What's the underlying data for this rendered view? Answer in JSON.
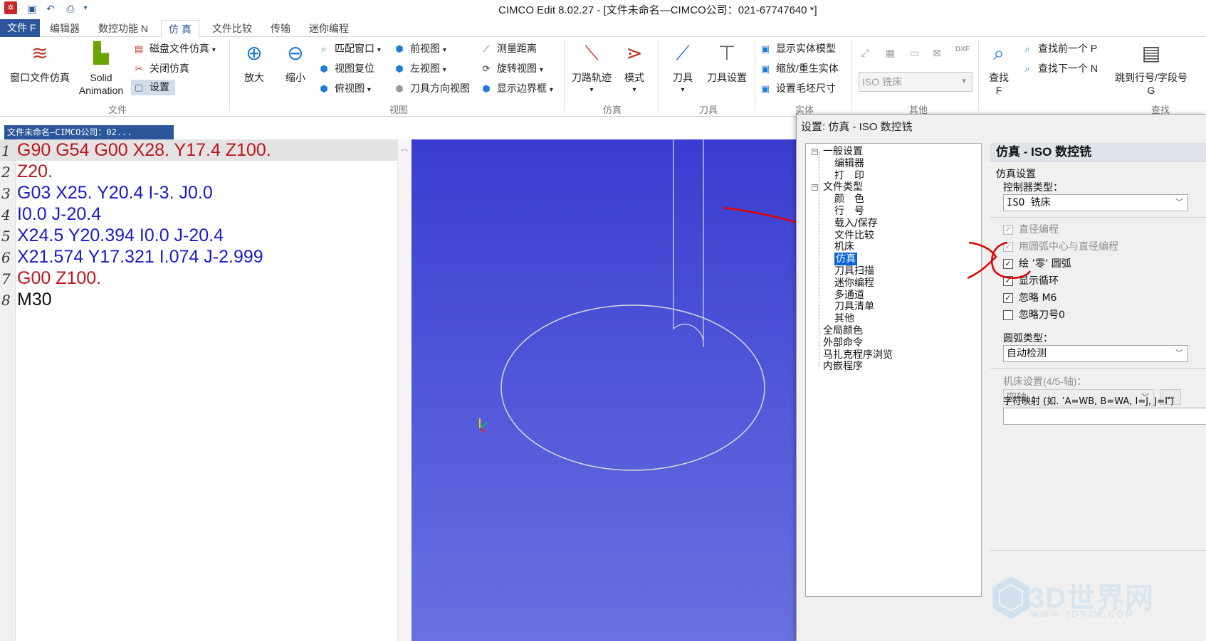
{
  "window": {
    "title": "CIMCO Edit 8.02.27 - [文件未命名—CIMCO公司：021-67747640 *]"
  },
  "tabs": [
    {
      "label": "文件 F"
    },
    {
      "label": "编辑器"
    },
    {
      "label": "数控功能 N"
    },
    {
      "label": "仿 真"
    },
    {
      "label": "文件比较"
    },
    {
      "label": "传输"
    },
    {
      "label": "迷你编程"
    }
  ],
  "ribbon": {
    "file_group": {
      "window_sim": "窗口文件仿真",
      "solid_animation": "Solid Animation",
      "solid_line1": "Solid",
      "solid_line2": "Animation",
      "disk_sim": "磁盘文件仿真",
      "close_sim": "关闭仿真",
      "settings": "设置",
      "label": "文件"
    },
    "view_group": {
      "zoom_in": "放大",
      "zoom_out": "缩小",
      "fit_window": "匹配窗口",
      "view_reset": "视图复位",
      "top_view": "俯视图",
      "front_view": "前视图",
      "left_view": "左视图",
      "tool_dir_view": "刀具方向视图",
      "measure": "测量距离",
      "rotate_view": "旋转视图",
      "show_bounds": "显示边界框",
      "label": "视图"
    },
    "sim_group": {
      "toolpath": "刀路轨迹",
      "mode": "模式",
      "label": "仿真"
    },
    "tool_group": {
      "tool": "刀具",
      "tool_setup": "刀具设置",
      "label": "刀具"
    },
    "solid_group": {
      "show_solid": "显示实体模型",
      "scale_regen": "缩放/重生实体",
      "stock_size": "设置毛坯尺寸",
      "label": "实体"
    },
    "other_group": {
      "machine_combo": "ISO 铣床",
      "label": "其他"
    },
    "find_group": {
      "find": "查找",
      "find_key": "F",
      "find_prev": "查找前一个 P",
      "find_next": "查找下一个 N",
      "goto": "跳到行号/字段号",
      "goto_key": "G",
      "label": "查找"
    }
  },
  "editor": {
    "doc_tab": "文件未命名—CIMCO公司：02...",
    "lines": [
      {
        "num": "1",
        "code": "G90 G54 G00 X28. Y17.4 Z100.",
        "color": "#c0141c"
      },
      {
        "num": "2",
        "code": "Z20.",
        "color": "#c0141c"
      },
      {
        "num": "3",
        "code": "G03 X25. Y20.4 I-3. J0.0",
        "color": "#1a1acc"
      },
      {
        "num": "4",
        "code": "I0.0 J-20.4",
        "color": "#1a1acc"
      },
      {
        "num": "5",
        "code": "X24.5 Y20.394 I0.0 J-20.4",
        "color": "#1a1acc"
      },
      {
        "num": "6",
        "code": "X21.574 Y17.321 I.074 J-2.999",
        "color": "#1a1acc"
      },
      {
        "num": "7",
        "code": "G00 Z100.",
        "color": "#c0141c"
      },
      {
        "num": "8",
        "code": "M30",
        "color": "#111111"
      }
    ]
  },
  "dialog": {
    "title": "设置: 仿真 - ISO 数控铣",
    "tree": [
      {
        "label": "一般设置",
        "level": 0,
        "expander": "−"
      },
      {
        "label": "编辑器",
        "level": 1
      },
      {
        "label": "打　印",
        "level": 1
      },
      {
        "label": "文件类型",
        "level": 0,
        "expander": "−"
      },
      {
        "label": "颜　色",
        "level": 1
      },
      {
        "label": "行　号",
        "level": 1
      },
      {
        "label": "载入/保存",
        "level": 1
      },
      {
        "label": "文件比较",
        "level": 1
      },
      {
        "label": "机床",
        "level": 1
      },
      {
        "label": "仿真",
        "level": 1,
        "selected": true
      },
      {
        "label": "刀具扫描",
        "level": 1
      },
      {
        "label": "迷你编程",
        "level": 1
      },
      {
        "label": "多通道",
        "level": 1
      },
      {
        "label": "刀具清单",
        "level": 1
      },
      {
        "label": "其他",
        "level": 1
      },
      {
        "label": "全局颜色",
        "level": 0
      },
      {
        "label": "外部命令",
        "level": 0
      },
      {
        "label": "马扎克程序浏览",
        "level": 0
      },
      {
        "label": "内嵌程序",
        "level": 0
      }
    ],
    "panel": {
      "header": "仿真 - ISO 数控铣",
      "section": "仿真设置",
      "controller_label": "控制器类型：",
      "controller_value": "ISO 铣床",
      "checkboxes": [
        {
          "label": "直径编程",
          "checked": true,
          "disabled": true
        },
        {
          "label": "用圆弧中心与直径编程",
          "checked": true,
          "disabled": true
        },
        {
          "label": "绘 ’零’ 圆弧",
          "checked": true,
          "disabled": false
        },
        {
          "label": "显示循环",
          "checked": true,
          "disabled": false
        },
        {
          "label": "忽略 M6",
          "checked": true,
          "disabled": false
        },
        {
          "label": "忽略刀号0",
          "checked": false,
          "disabled": false
        }
      ],
      "arc_type_label": "圆弧类型：",
      "arc_type_value": "自动检测",
      "machine_label": "机床设置(4/5-轴)：",
      "machine_value": "四轴",
      "mapping_label": "字符映射 (如. ’A=WB, B=WA, I=J, J=I’)"
    }
  },
  "watermark": {
    "text": "3D世界网",
    "sub": "WWW.3DSJW.COM"
  },
  "colors": {
    "accent": "#2b579a",
    "viewport_top": "#3a3ccf",
    "viewport_bottom": "#6a70e0",
    "annotation": "#e00000",
    "toolpath": "#d8d8d8"
  }
}
